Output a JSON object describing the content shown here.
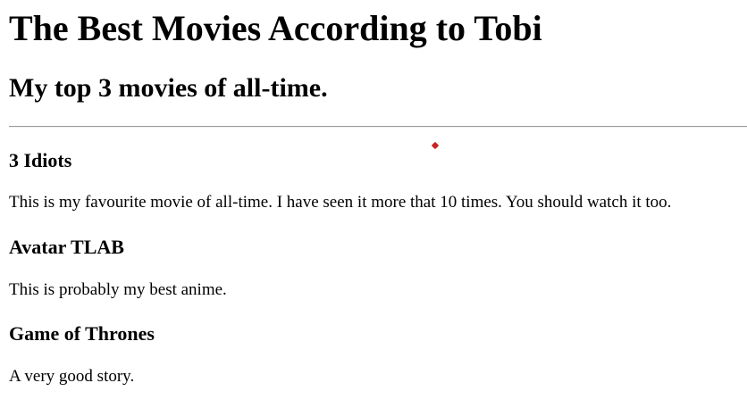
{
  "page": {
    "title": "The Best Movies According to Tobi",
    "subtitle": "My top 3 movies of all-time."
  },
  "movies": [
    {
      "title": "3 Idiots",
      "description": "This is my favourite movie of all-time. I have seen it more that 10 times. You should watch it too."
    },
    {
      "title": "Avatar TLAB",
      "description": "This is probably my best anime."
    },
    {
      "title": "Game of Thrones",
      "description": "A very good story."
    }
  ],
  "colors": {
    "text": "#000000",
    "background": "#ffffff",
    "rule": "#9a9a9a",
    "cursor_marker": "#cc2222"
  }
}
